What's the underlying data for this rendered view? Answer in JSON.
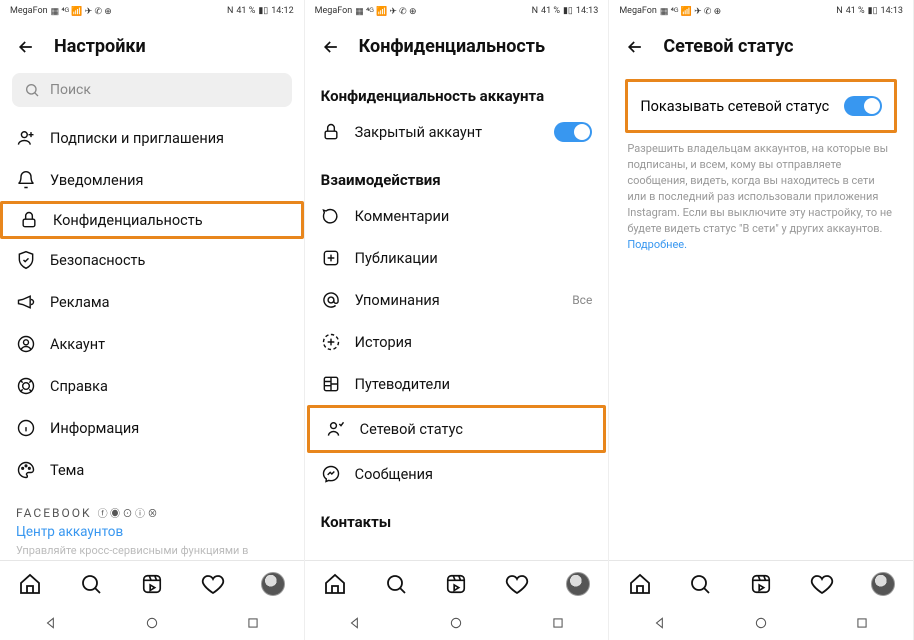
{
  "statusBar": {
    "carrier": "MegaFon",
    "batteryText": "41 %",
    "nfc": "N",
    "time1": "14:12",
    "time2": "14:13",
    "time3": "14:13"
  },
  "screen1": {
    "title": "Настройки",
    "searchPlaceholder": "Поиск",
    "items": {
      "subscriptions": "Подписки и приглашения",
      "notifications": "Уведомления",
      "privacy": "Конфиденциальность",
      "security": "Безопасность",
      "ads": "Реклама",
      "account": "Аккаунт",
      "help": "Справка",
      "info": "Информация",
      "theme": "Тема"
    },
    "footerBrand": "FACEBOOK",
    "accountsCenter": "Центр аккаунтов",
    "fadedText": "Управляйте кросс-сервисными функциями в"
  },
  "screen2": {
    "title": "Конфиденциальность",
    "section1": "Конфиденциальность аккаунта",
    "privateAccount": "Закрытый аккаунт",
    "section2": "Взаимодействия",
    "items": {
      "comments": "Комментарии",
      "publications": "Публикации",
      "mentions": "Упоминания",
      "mentionsAux": "Все",
      "history": "История",
      "guides": "Путеводители",
      "activityStatus": "Сетевой статус",
      "messages": "Сообщения"
    },
    "section3": "Контакты"
  },
  "screen3": {
    "title": "Сетевой статус",
    "toggleLabel": "Показывать сетевой статус",
    "description": "Разрешить владельцам аккаунтов, на которые вы подписаны, и всем, кому вы отправляете сообщения, видеть, когда вы находитесь в сети или в последний раз использовали приложения Instagram. Если вы выключите эту настройку, то не будете видеть статус \"В сети\" у других аккаунтов.",
    "more": "Подробнее."
  }
}
